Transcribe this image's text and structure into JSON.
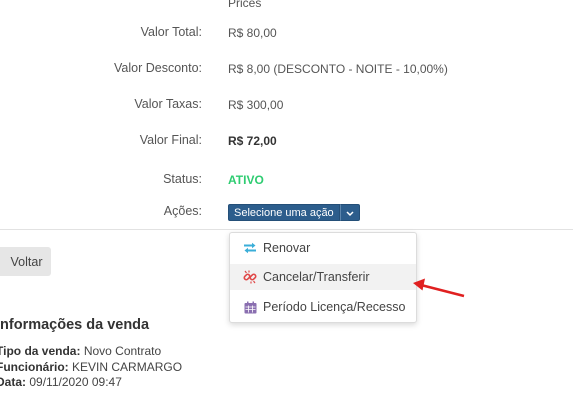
{
  "fields": {
    "partial_value": "Prices",
    "valor_total": {
      "label": "Valor Total:",
      "value": "R$ 80,00"
    },
    "valor_desconto": {
      "label": "Valor Desconto:",
      "value": "R$ 8,00 (DESCONTO - NOITE - 10,00%)"
    },
    "valor_taxas": {
      "label": "Valor Taxas:",
      "value": "R$ 300,00"
    },
    "valor_final": {
      "label": "Valor Final:",
      "value": "R$ 72,00"
    },
    "status": {
      "label": "Status:",
      "value": "ATIVO"
    },
    "acoes": {
      "label": "Ações:",
      "button": "Selecione uma ação"
    }
  },
  "dropdown": {
    "items": [
      {
        "label": "Renovar",
        "icon": "exchange-icon"
      },
      {
        "label": "Cancelar/Transferir",
        "icon": "chain-broken-icon"
      },
      {
        "label": "Período Licença/Recesso",
        "icon": "calendar-icon"
      }
    ]
  },
  "back_button": "Voltar",
  "sale_info": {
    "title": "Informações da venda",
    "tipo": {
      "label": "Tipo da venda:",
      "value": "Novo Contrato"
    },
    "funcionario": {
      "label": "Funcionário:",
      "value": "KEVIN CARMARGO"
    },
    "data": {
      "label": "Data:",
      "value": "09/11/2020 09:47"
    }
  },
  "colors": {
    "status_active": "#2ecc71",
    "action_button": "#2c5d8c",
    "annotation_arrow": "#e02020"
  }
}
